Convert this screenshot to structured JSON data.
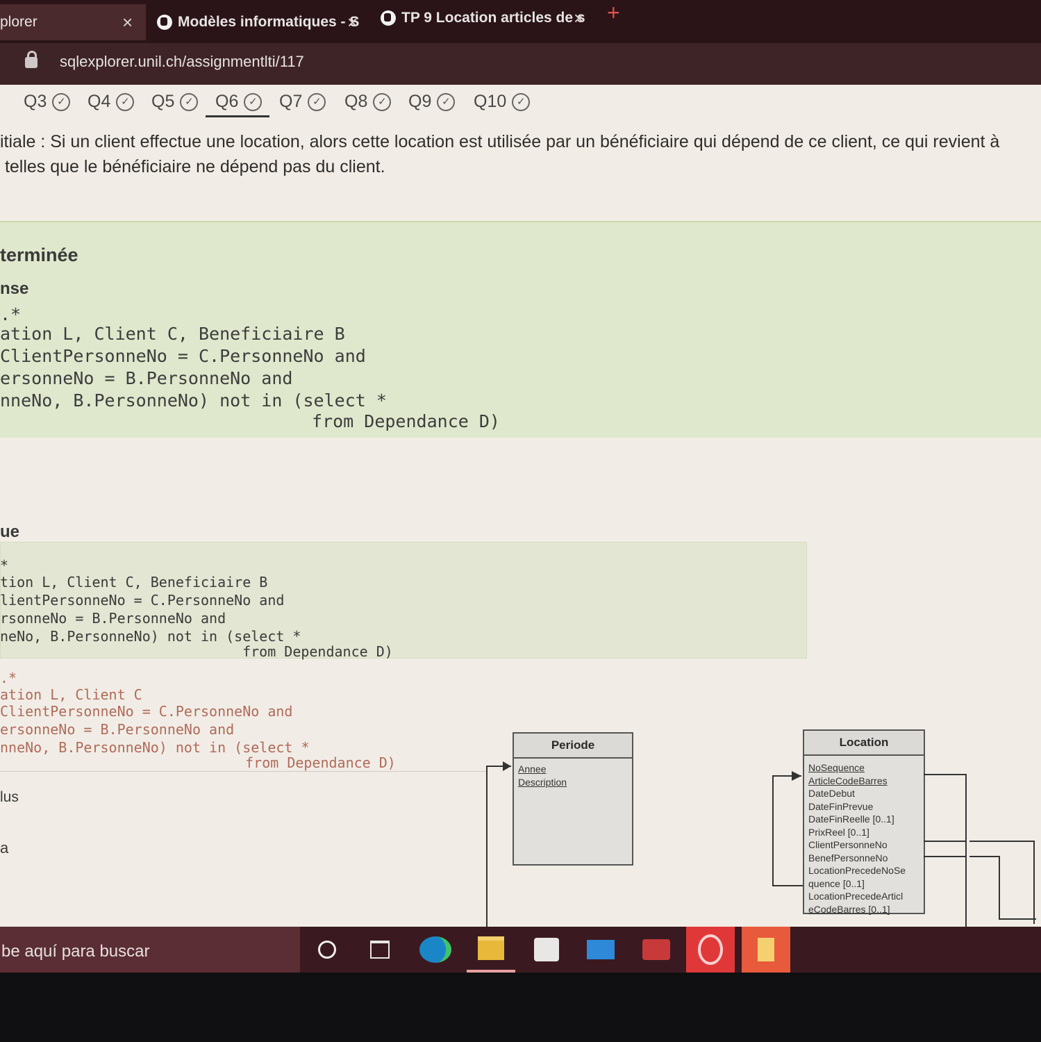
{
  "browser": {
    "tabs": [
      {
        "title": "plorer",
        "active": true
      },
      {
        "title": "Modèles informatiques - S"
      },
      {
        "title": "TP 9 Location articles de s"
      }
    ],
    "new_tab": "+",
    "close": "×",
    "url": "sqlexplorer.unil.ch/assignmentlti/117"
  },
  "question_nav": [
    {
      "label": "Q3",
      "done": true
    },
    {
      "label": "Q4",
      "done": true
    },
    {
      "label": "Q5",
      "done": true
    },
    {
      "label": "Q6",
      "done": true,
      "current": true
    },
    {
      "label": "Q7",
      "done": true
    },
    {
      "label": "Q8",
      "done": true
    },
    {
      "label": "Q9",
      "done": true
    },
    {
      "label": "Q10",
      "done": true
    }
  ],
  "check_glyph": "✓",
  "question": {
    "line1": "itiale : Si un client effectue une location, alors cette location est utilisée par un bénéficiaire qui dépend de ce client, ce qui revient à",
    "line2": " telles que le bénéficiaire ne dépend pas du client."
  },
  "result": {
    "status": "terminée",
    "answer_label": "nse",
    "code": [
      ".*",
      "ation L, Client C, Beneficiaire B",
      "ClientPersonneNo = C.PersonneNo and",
      "ersonneNo = B.PersonneNo and",
      "nneNo, B.PersonneNo) not in (select *",
      "                    from Dependance D)"
    ]
  },
  "solution": {
    "label": "ue",
    "code": [
      "*",
      "tion L, Client C, Beneficiaire B",
      "lientPersonneNo = C.PersonneNo and",
      "rsonneNo = B.PersonneNo and",
      "neNo, B.PersonneNo) not in (select *",
      "                          from Dependance D)"
    ]
  },
  "diff_code": [
    ".*",
    "ation L, Client C",
    "ClientPersonneNo = C.PersonneNo and",
    "ersonneNo = B.PersonneNo and",
    "nneNo, B.PersonneNo) not in (select *",
    "                           from Dependance D)"
  ],
  "plus_label": "lus",
  "a_label": "a",
  "uml": {
    "periode": {
      "title": "Periode",
      "attrs": [
        "Annee",
        "Description"
      ]
    },
    "location": {
      "title": "Location",
      "attrs": [
        "NoSequence",
        "ArticleCodeBarres",
        "DateDebut",
        "DateFinPrevue",
        "DateFinReelle [0..1]",
        "PrixReel [0..1]",
        "ClientPersonneNo",
        "BenefPersonneNo",
        "LocationPrecedeNoSe",
        "quence [0..1]",
        "LocationPrecedeArticl",
        "eCodeBarres [0..1]"
      ]
    }
  },
  "taskbar": {
    "search_placeholder": "be aquí para buscar"
  },
  "colors": {
    "correct_bg": "#dfe8cc",
    "diff_text": "#b06a5a",
    "taskbar": "#3a1a20"
  }
}
